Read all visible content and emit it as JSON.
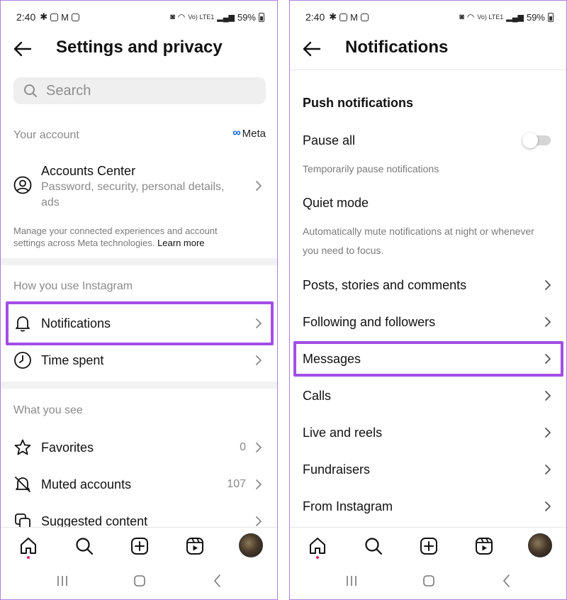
{
  "colors": {
    "highlight": "#a24ee6",
    "meta_blue": "#0a66e0",
    "muted": "#8a8a8a",
    "notification_dot": "#e0245e"
  },
  "status_bar": {
    "time": "2:40",
    "battery": "59%",
    "network": "Vo) LTE1"
  },
  "left": {
    "header": {
      "title": "Settings and privacy",
      "back_icon": "arrow-left-icon"
    },
    "search": {
      "placeholder": "Search"
    },
    "your_account": {
      "label": "Your account",
      "meta_logo": "Meta",
      "accounts_center": {
        "title": "Accounts Center",
        "subtitle": "Password, security, personal details, ads",
        "icon": "user-circle-icon"
      },
      "note": "Manage your connected experiences and account settings across Meta technologies.",
      "learn_more": "Learn more"
    },
    "how_you_use": {
      "label": "How you use Instagram",
      "items": [
        {
          "label": "Notifications",
          "icon": "bell-icon",
          "highlighted": true
        },
        {
          "label": "Time spent",
          "icon": "clock-icon"
        }
      ]
    },
    "what_you_see": {
      "label": "What you see",
      "items": [
        {
          "label": "Favorites",
          "count": "0",
          "icon": "star-icon"
        },
        {
          "label": "Muted accounts",
          "count": "107",
          "icon": "bell-off-icon"
        },
        {
          "label": "Suggested content",
          "icon": "suggested-content-icon"
        }
      ]
    }
  },
  "right": {
    "header": {
      "title": "Notifications",
      "back_icon": "arrow-left-icon"
    },
    "push_title": "Push notifications",
    "pause_all": {
      "label": "Pause all",
      "enabled": false,
      "description": "Temporarily pause notifications"
    },
    "quiet_mode": {
      "label": "Quiet mode",
      "description_line1": "Automatically mute notifications at night or whenever",
      "description_line2": "you need to focus."
    },
    "items": [
      {
        "label": "Posts, stories and comments"
      },
      {
        "label": "Following and followers"
      },
      {
        "label": "Messages",
        "highlighted": true
      },
      {
        "label": "Calls"
      },
      {
        "label": "Live and reels"
      },
      {
        "label": "Fundraisers"
      },
      {
        "label": "From Instagram"
      }
    ]
  },
  "bottom_nav": {
    "items": [
      "home-icon",
      "search-icon",
      "create-icon",
      "reels-icon",
      "profile-avatar"
    ],
    "active": "home-icon"
  },
  "system_nav": {
    "items": [
      "recents-icon",
      "home-button-icon",
      "back-chevron-icon"
    ]
  }
}
